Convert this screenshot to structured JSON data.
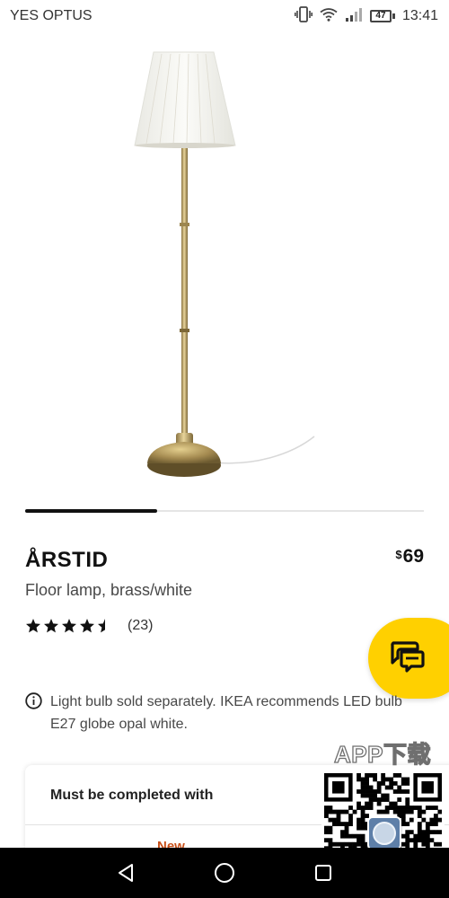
{
  "status_bar": {
    "carrier": "YES OPTUS",
    "battery": "47",
    "time": "13:41",
    "icons": [
      "vibrate-icon",
      "wifi-icon",
      "signal-icon",
      "battery-icon"
    ]
  },
  "gallery": {
    "image_icon": "floor-lamp-image",
    "progress": 0.33
  },
  "product": {
    "name": "ÅRSTID",
    "currency": "$",
    "price": "69",
    "description": "Floor lamp, brass/white",
    "rating": 4.5,
    "review_count": "(23)"
  },
  "chat_button": {
    "icon": "chat-icon",
    "color": "#ffd000"
  },
  "info": {
    "icon": "info-icon",
    "text": "Light bulb sold separately. IKEA recommends LED bulb E27 globe opal white."
  },
  "card": {
    "title": "Must be completed with",
    "badge": "New",
    "badge_color": "#c8501a"
  },
  "watermark": {
    "text": "APP下载",
    "icon": "qr-code-icon"
  },
  "nav_bar": {
    "buttons": [
      "back-icon",
      "home-icon",
      "recents-icon"
    ]
  }
}
